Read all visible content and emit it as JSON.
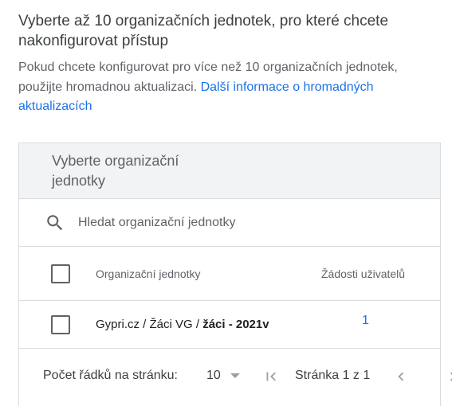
{
  "heading": "Vyberte až 10 organizačních jednotek, pro které chcete nakonfigurovat přístup",
  "description": {
    "text": "Pokud chcete konfigurovat pro více než 10 organizačních jednotek, použijte hromadnou aktualizaci.",
    "link": "Další informace o hromadných aktualizacích"
  },
  "panel": {
    "title": "Vyberte organizační jednotky",
    "search_placeholder": "Hledat organizační jednotky",
    "columns": {
      "name": "Organizační jednotky",
      "requests": "Žádosti uživatelů"
    },
    "rows": [
      {
        "path_prefix": "Gypri.cz / Žáci VG / ",
        "path_last": "žáci - 2021v",
        "requests": "1",
        "checked": false
      }
    ],
    "footer": {
      "rows_per_page_label": "Počet řádků na stránku:",
      "rows_per_page_value": "10",
      "page_label": "Stránka 1 z 1"
    }
  },
  "colors": {
    "link": "#1a73e8",
    "header_bg": "#f1f3f4",
    "border": "#dadce0"
  }
}
